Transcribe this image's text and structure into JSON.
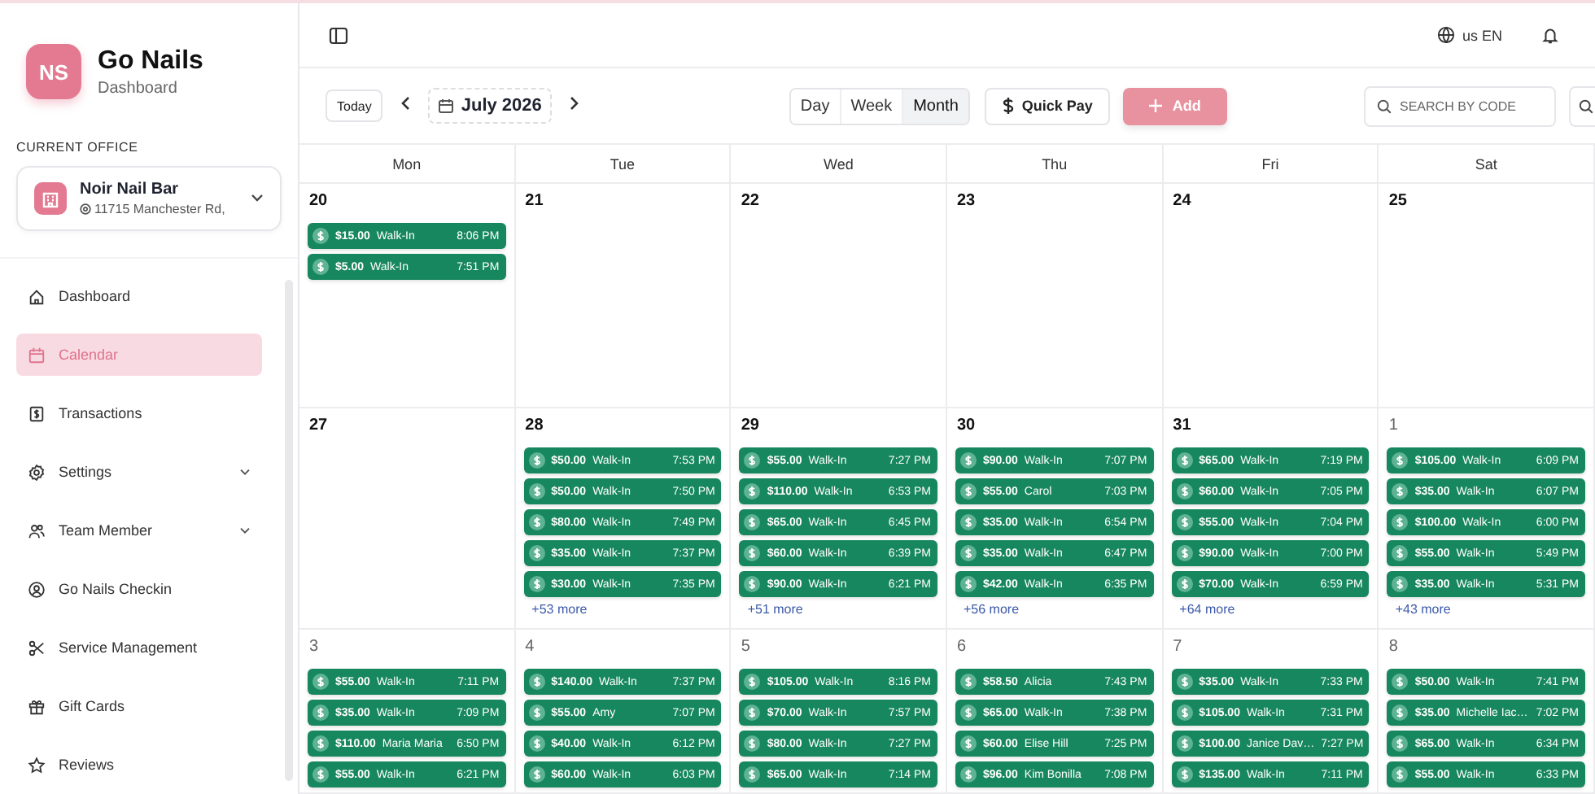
{
  "brand": {
    "initials": "NS",
    "name": "Go Nails",
    "subtitle": "Dashboard"
  },
  "office": {
    "heading": "CURRENT OFFICE",
    "name": "Noir Nail Bar",
    "address": "11715 Manchester Rd,"
  },
  "sidebar": {
    "items": [
      {
        "label": "Dashboard",
        "selected": false
      },
      {
        "label": "Calendar",
        "selected": true
      },
      {
        "label": "Transactions",
        "selected": false
      },
      {
        "label": "Settings",
        "selected": false,
        "expanded": false
      },
      {
        "label": "Team Member",
        "selected": false,
        "expanded": false
      },
      {
        "label": "Go Nails Checkin",
        "selected": false
      },
      {
        "label": "Service Management",
        "selected": false
      },
      {
        "label": "Gift Cards",
        "selected": false
      },
      {
        "label": "Reviews",
        "selected": false
      }
    ]
  },
  "topbar": {
    "language": "us EN"
  },
  "toolbar": {
    "today": "Today",
    "month": "July 2026",
    "views": [
      {
        "label": "Day",
        "selected": false
      },
      {
        "label": "Week",
        "selected": false
      },
      {
        "label": "Month",
        "selected": true
      }
    ],
    "quick_pay": "Quick Pay",
    "add": "Add",
    "search": {
      "placeholder": "SEARCH BY CODE"
    }
  },
  "calendar": {
    "weekdays": [
      "Mon",
      "Tue",
      "Wed",
      "Thu",
      "Fri",
      "Sat"
    ],
    "weeks": [
      {
        "days": [
          {
            "date": "20",
            "in_month": true,
            "events": [
              {
                "amount": "$15.00",
                "name": "Walk-In",
                "time": "8:06 PM"
              },
              {
                "amount": "$5.00",
                "name": "Walk-In",
                "time": "7:51 PM"
              }
            ]
          },
          {
            "date": "21",
            "in_month": true
          },
          {
            "date": "22",
            "in_month": true
          },
          {
            "date": "23",
            "in_month": true
          },
          {
            "date": "24",
            "in_month": true
          },
          {
            "date": "25",
            "in_month": true
          }
        ]
      },
      {
        "days": [
          {
            "date": "27",
            "in_month": true
          },
          {
            "date": "28",
            "in_month": true,
            "more": "+53 more",
            "events": [
              {
                "amount": "$50.00",
                "name": "Walk-In",
                "time": "7:53 PM"
              },
              {
                "amount": "$50.00",
                "name": "Walk-In",
                "time": "7:50 PM"
              },
              {
                "amount": "$80.00",
                "name": "Walk-In",
                "time": "7:49 PM"
              },
              {
                "amount": "$35.00",
                "name": "Walk-In",
                "time": "7:37 PM"
              },
              {
                "amount": "$30.00",
                "name": "Walk-In",
                "time": "7:35 PM"
              }
            ]
          },
          {
            "date": "29",
            "in_month": true,
            "more": "+51 more",
            "events": [
              {
                "amount": "$55.00",
                "name": "Walk-In",
                "time": "7:27 PM"
              },
              {
                "amount": "$110.00",
                "name": "Walk-In",
                "time": "6:53 PM"
              },
              {
                "amount": "$65.00",
                "name": "Walk-In",
                "time": "6:45 PM"
              },
              {
                "amount": "$60.00",
                "name": "Walk-In",
                "time": "6:39 PM"
              },
              {
                "amount": "$90.00",
                "name": "Walk-In",
                "time": "6:21 PM"
              }
            ]
          },
          {
            "date": "30",
            "in_month": true,
            "more": "+56 more",
            "events": [
              {
                "amount": "$90.00",
                "name": "Walk-In",
                "time": "7:07 PM"
              },
              {
                "amount": "$55.00",
                "name": "Carol",
                "time": "7:03 PM"
              },
              {
                "amount": "$35.00",
                "name": "Walk-In",
                "time": "6:54 PM"
              },
              {
                "amount": "$35.00",
                "name": "Walk-In",
                "time": "6:47 PM"
              },
              {
                "amount": "$42.00",
                "name": "Walk-In",
                "time": "6:35 PM"
              }
            ]
          },
          {
            "date": "31",
            "in_month": true,
            "more": "+64 more",
            "events": [
              {
                "amount": "$65.00",
                "name": "Walk-In",
                "time": "7:19 PM"
              },
              {
                "amount": "$60.00",
                "name": "Walk-In",
                "time": "7:05 PM"
              },
              {
                "amount": "$55.00",
                "name": "Walk-In",
                "time": "7:04 PM"
              },
              {
                "amount": "$90.00",
                "name": "Walk-In",
                "time": "7:00 PM"
              },
              {
                "amount": "$70.00",
                "name": "Walk-In",
                "time": "6:59 PM"
              }
            ]
          },
          {
            "date": "1",
            "in_month": false,
            "more": "+43 more",
            "events": [
              {
                "amount": "$105.00",
                "name": "Walk-In",
                "time": "6:09 PM"
              },
              {
                "amount": "$35.00",
                "name": "Walk-In",
                "time": "6:07 PM"
              },
              {
                "amount": "$100.00",
                "name": "Walk-In",
                "time": "6:00 PM"
              },
              {
                "amount": "$55.00",
                "name": "Walk-In",
                "time": "5:49 PM"
              },
              {
                "amount": "$35.00",
                "name": "Walk-In",
                "time": "5:31 PM"
              }
            ]
          }
        ]
      },
      {
        "days": [
          {
            "date": "3",
            "in_month": false,
            "events": [
              {
                "amount": "$55.00",
                "name": "Walk-In",
                "time": "7:11 PM"
              },
              {
                "amount": "$35.00",
                "name": "Walk-In",
                "time": "7:09 PM"
              },
              {
                "amount": "$110.00",
                "name": "Maria Maria",
                "time": "6:50 PM"
              },
              {
                "amount": "$55.00",
                "name": "Walk-In",
                "time": "6:21 PM"
              }
            ]
          },
          {
            "date": "4",
            "in_month": false,
            "events": [
              {
                "amount": "$140.00",
                "name": "Walk-In",
                "time": "7:37 PM"
              },
              {
                "amount": "$55.00",
                "name": "Amy",
                "time": "7:07 PM"
              },
              {
                "amount": "$40.00",
                "name": "Walk-In",
                "time": "6:12 PM"
              },
              {
                "amount": "$60.00",
                "name": "Walk-In",
                "time": "6:03 PM"
              }
            ]
          },
          {
            "date": "5",
            "in_month": false,
            "events": [
              {
                "amount": "$105.00",
                "name": "Walk-In",
                "time": "8:16 PM"
              },
              {
                "amount": "$70.00",
                "name": "Walk-In",
                "time": "7:57 PM"
              },
              {
                "amount": "$80.00",
                "name": "Walk-In",
                "time": "7:27 PM"
              },
              {
                "amount": "$65.00",
                "name": "Walk-In",
                "time": "7:14 PM"
              }
            ]
          },
          {
            "date": "6",
            "in_month": false,
            "events": [
              {
                "amount": "$58.50",
                "name": "Alicia",
                "time": "7:43 PM"
              },
              {
                "amount": "$65.00",
                "name": "Walk-In",
                "time": "7:38 PM"
              },
              {
                "amount": "$60.00",
                "name": "Elise Hill",
                "time": "7:25 PM"
              },
              {
                "amount": "$96.00",
                "name": "Kim Bonilla",
                "time": "7:08 PM"
              }
            ]
          },
          {
            "date": "7",
            "in_month": false,
            "events": [
              {
                "amount": "$35.00",
                "name": "Walk-In",
                "time": "7:33 PM"
              },
              {
                "amount": "$105.00",
                "name": "Walk-In",
                "time": "7:31 PM"
              },
              {
                "amount": "$100.00",
                "name": "Janice Dav…",
                "time": "7:27 PM"
              },
              {
                "amount": "$135.00",
                "name": "Walk-In",
                "time": "7:11 PM"
              }
            ]
          },
          {
            "date": "8",
            "in_month": false,
            "events": [
              {
                "amount": "$50.00",
                "name": "Walk-In",
                "time": "7:41 PM"
              },
              {
                "amount": "$35.00",
                "name": "Michelle Iac…",
                "time": "7:02 PM"
              },
              {
                "amount": "$65.00",
                "name": "Walk-In",
                "time": "6:34 PM"
              },
              {
                "amount": "$55.00",
                "name": "Walk-In",
                "time": "6:33 PM"
              }
            ]
          }
        ]
      }
    ]
  }
}
